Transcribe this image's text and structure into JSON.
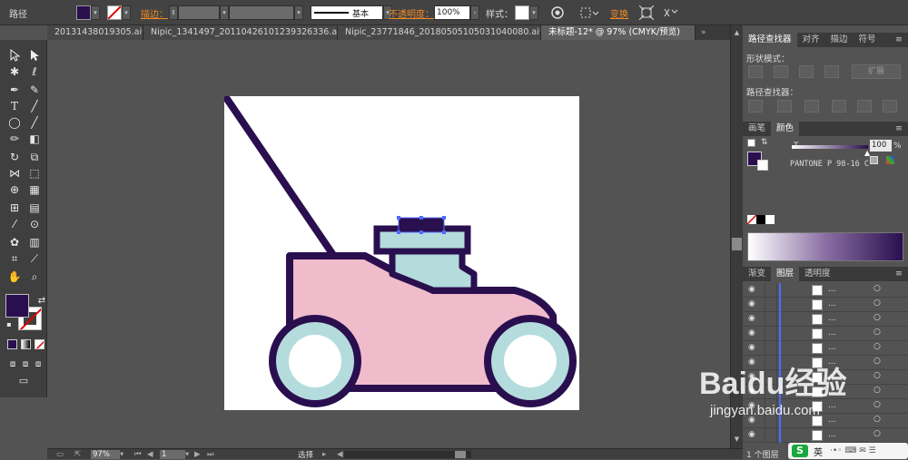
{
  "control_bar": {
    "path_label": "路径",
    "stroke_label": "描边：",
    "brush_label": "基本",
    "opacity_label": "不透明度：",
    "opacity_value": "100%",
    "style_label": "样式：",
    "transform_label": "变换"
  },
  "tabs": [
    {
      "label": "20131438019305.ai*"
    },
    {
      "label": "Nipic_1341497_20110426101239326336.ai*"
    },
    {
      "label": "Nipic_23771846_20180505105031040080.ai*"
    },
    {
      "label": "未标题-12* @ 97% (CMYK/预览)"
    }
  ],
  "status_bar": {
    "zoom": "97%",
    "page": "1",
    "mode": "选择"
  },
  "pathfinder": {
    "tabs": [
      "路径查找器",
      "对齐",
      "描边",
      "符号"
    ],
    "shape_modes_label": "形状模式：",
    "expand_label": "扩展",
    "pathfinders_label": "路径查找器："
  },
  "color_panel": {
    "tabs": [
      "画笔",
      "颜色"
    ],
    "tint_label": "T",
    "tint_value": "100",
    "percent": "%",
    "swatch_name": "PANTONE P 98-16 C"
  },
  "layers_panel": {
    "tabs": [
      "渐变",
      "图层",
      "透明度"
    ],
    "row_label": "...",
    "row_count": 11,
    "footer": "1 个图层"
  },
  "colors": {
    "fill": "#2a0f4f",
    "body_pink": "#f0bccb",
    "mint": "#b4dcdc",
    "outline": "#2a0f4f",
    "ui_orange": "#f08a24"
  },
  "watermark": {
    "brand": "Baidu经验",
    "url": "jingyan.baidu.com"
  },
  "tray": {
    "ime_label": "英"
  }
}
